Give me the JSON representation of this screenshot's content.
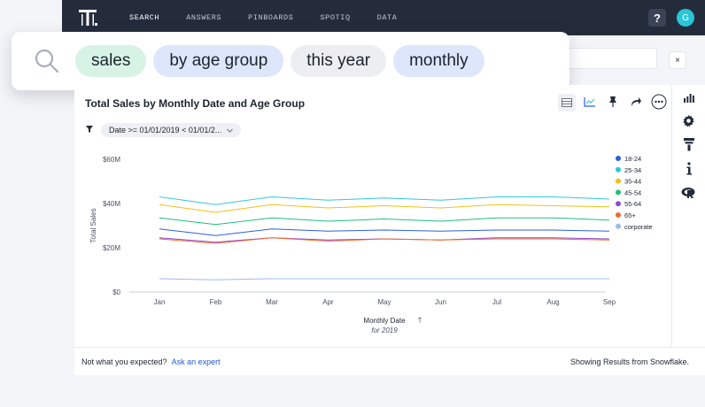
{
  "nav": {
    "items": [
      "SEARCH",
      "ANSWERS",
      "PINBOARDS",
      "SPOTIQ",
      "DATA"
    ],
    "help": "?",
    "avatar": "G",
    "logo_icon": "thoughtspot-logo-icon"
  },
  "search": {
    "tokens": [
      {
        "text": "sales",
        "kind": "measure",
        "color": "#d7f3e6"
      },
      {
        "text": "by age group",
        "kind": "attribute",
        "color": "#dde6fb"
      },
      {
        "text": "this year",
        "kind": "filter",
        "color": "#eceef1"
      },
      {
        "text": "monthly",
        "kind": "attribute",
        "color": "#dde6fb"
      }
    ],
    "clear_icon": "×"
  },
  "answer": {
    "title": "Total Sales by Monthly Date and Age Group",
    "filter_label": "Date >= 01/01/2019 < 01/01/2..."
  },
  "chart_data": {
    "type": "line",
    "xlabel": "Monthly Date",
    "xsublabel": "for 2019",
    "ylabel": "Total Sales",
    "categories": [
      "Jan",
      "Feb",
      "Mar",
      "Apr",
      "May",
      "Jun",
      "Jul",
      "Aug",
      "Sep"
    ],
    "yticks": [
      "$0",
      "$20M",
      "$40M",
      "$60M"
    ],
    "ylim": [
      0,
      60
    ],
    "legend_position": "right",
    "series": [
      {
        "name": "18-24",
        "color": "#2c5fde",
        "values": [
          28.5,
          25.5,
          28.5,
          27.5,
          28.0,
          27.5,
          28.0,
          28.0,
          27.5
        ]
      },
      {
        "name": "25-34",
        "color": "#2ec9d8",
        "values": [
          43.0,
          39.5,
          43.0,
          41.5,
          42.5,
          41.5,
          43.0,
          43.0,
          42.0
        ]
      },
      {
        "name": "35-44",
        "color": "#f2c018",
        "values": [
          39.5,
          36.0,
          39.5,
          38.0,
          39.0,
          38.0,
          39.5,
          39.0,
          38.5
        ]
      },
      {
        "name": "45-54",
        "color": "#1fbf7a",
        "values": [
          33.5,
          30.5,
          33.5,
          32.0,
          33.0,
          32.0,
          33.5,
          33.5,
          32.5
        ]
      },
      {
        "name": "55-64",
        "color": "#8e4ad6",
        "values": [
          24.5,
          22.5,
          24.5,
          23.5,
          24.0,
          23.5,
          24.5,
          24.5,
          24.0
        ]
      },
      {
        "name": "65+",
        "color": "#f26a2c",
        "values": [
          24.0,
          22.0,
          24.5,
          23.0,
          24.0,
          23.5,
          24.0,
          24.0,
          23.5
        ]
      },
      {
        "name": "corporate",
        "color": "#9bbcf2",
        "values": [
          6.0,
          5.5,
          6.0,
          6.0,
          6.0,
          6.0,
          6.0,
          6.0,
          6.0
        ]
      }
    ]
  },
  "footer": {
    "prompt": "Not what you expected?",
    "link": "Ask an expert",
    "source": "Showing Results from Snowflake."
  }
}
